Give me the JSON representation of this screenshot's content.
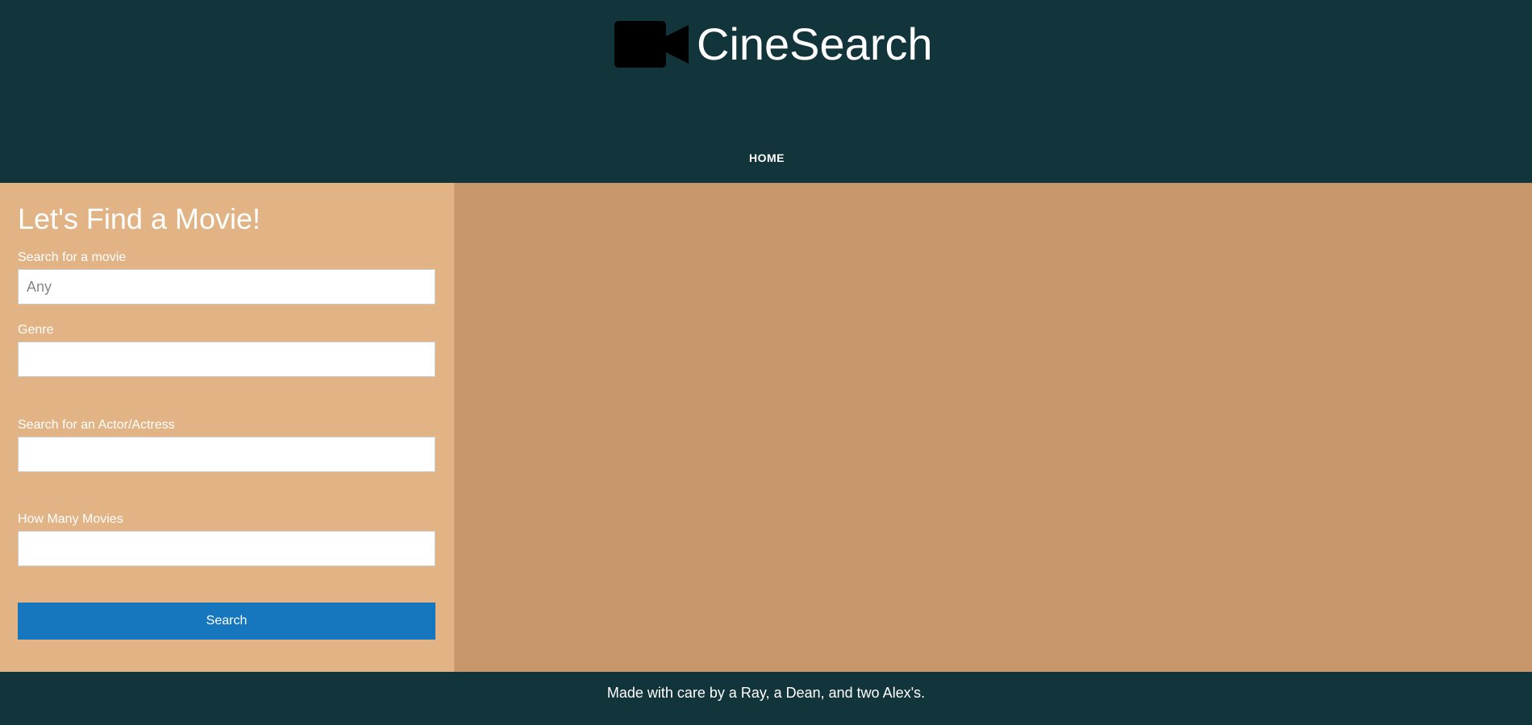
{
  "header": {
    "logo_icon": "video-camera-icon",
    "title": "CineSearch",
    "nav": [
      "HOME"
    ],
    "background": "#12343b"
  },
  "search_form": {
    "heading": "Let's Find a Movie!",
    "movie_label": "Search for a movie",
    "movie_placeholder": "Any",
    "movie_value": "",
    "genre_label": "Genre",
    "genre_value": "",
    "actor_label": "Search for an Actor/Actress",
    "actor_value": "",
    "count_label": "How Many Movies",
    "count_value": "",
    "submit_label": "Search",
    "button_color": "#1677be",
    "panel_color": "#e1b385"
  },
  "results": {
    "background": "#c8966b"
  },
  "footer": {
    "text": "Made with care by a Ray, a Dean, and two Alex's."
  }
}
